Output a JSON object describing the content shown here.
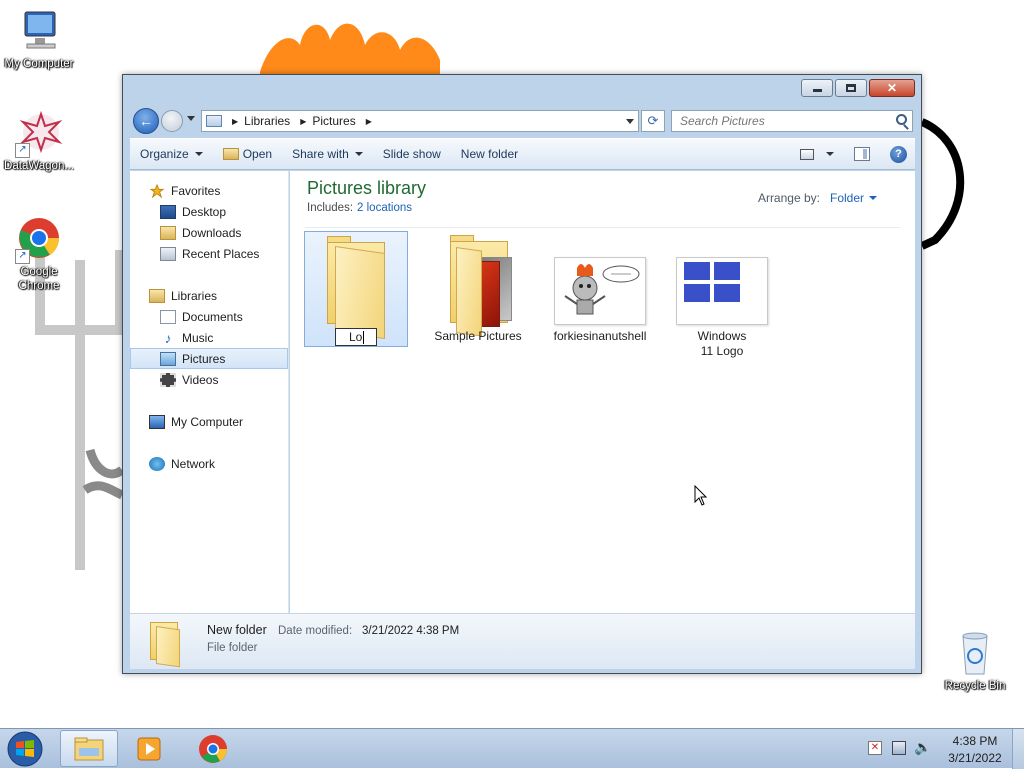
{
  "desktop": {
    "icons": [
      {
        "label": "My Computer"
      },
      {
        "label": "DataWagon..."
      },
      {
        "label": "Google Chrome"
      },
      {
        "label": "Recycle Bin"
      }
    ]
  },
  "window": {
    "breadcrumb": [
      "Libraries",
      "Pictures"
    ],
    "search_placeholder": "Search Pictures",
    "toolbar": {
      "organize": "Organize",
      "open": "Open",
      "share_with": "Share with",
      "slide_show": "Slide show",
      "new_folder": "New folder"
    },
    "nav": {
      "favorites": "Favorites",
      "desktop": "Desktop",
      "downloads": "Downloads",
      "recent_places": "Recent Places",
      "libraries": "Libraries",
      "documents": "Documents",
      "music": "Music",
      "pictures": "Pictures",
      "videos": "Videos",
      "my_computer": "My Computer",
      "network": "Network"
    },
    "library": {
      "title": "Pictures library",
      "includes_label": "Includes:",
      "includes_link": "2 locations",
      "arrange_label": "Arrange by:",
      "arrange_value": "Folder"
    },
    "items": [
      {
        "label": "",
        "rename_value": "Lo"
      },
      {
        "label": "Sample Pictures"
      },
      {
        "label": "forkiesinanutshell"
      },
      {
        "label": "Windows 11 Logo"
      }
    ],
    "details": {
      "name": "New folder",
      "modified_label": "Date modified:",
      "modified_value": "3/21/2022 4:38 PM",
      "type": "File folder"
    }
  },
  "taskbar": {
    "time": "4:38 PM",
    "date": "3/21/2022"
  },
  "colors": {
    "accent": "#1d63b6",
    "library_title": "#1f6b31",
    "windows_logo_blue": "#3a50c8"
  }
}
